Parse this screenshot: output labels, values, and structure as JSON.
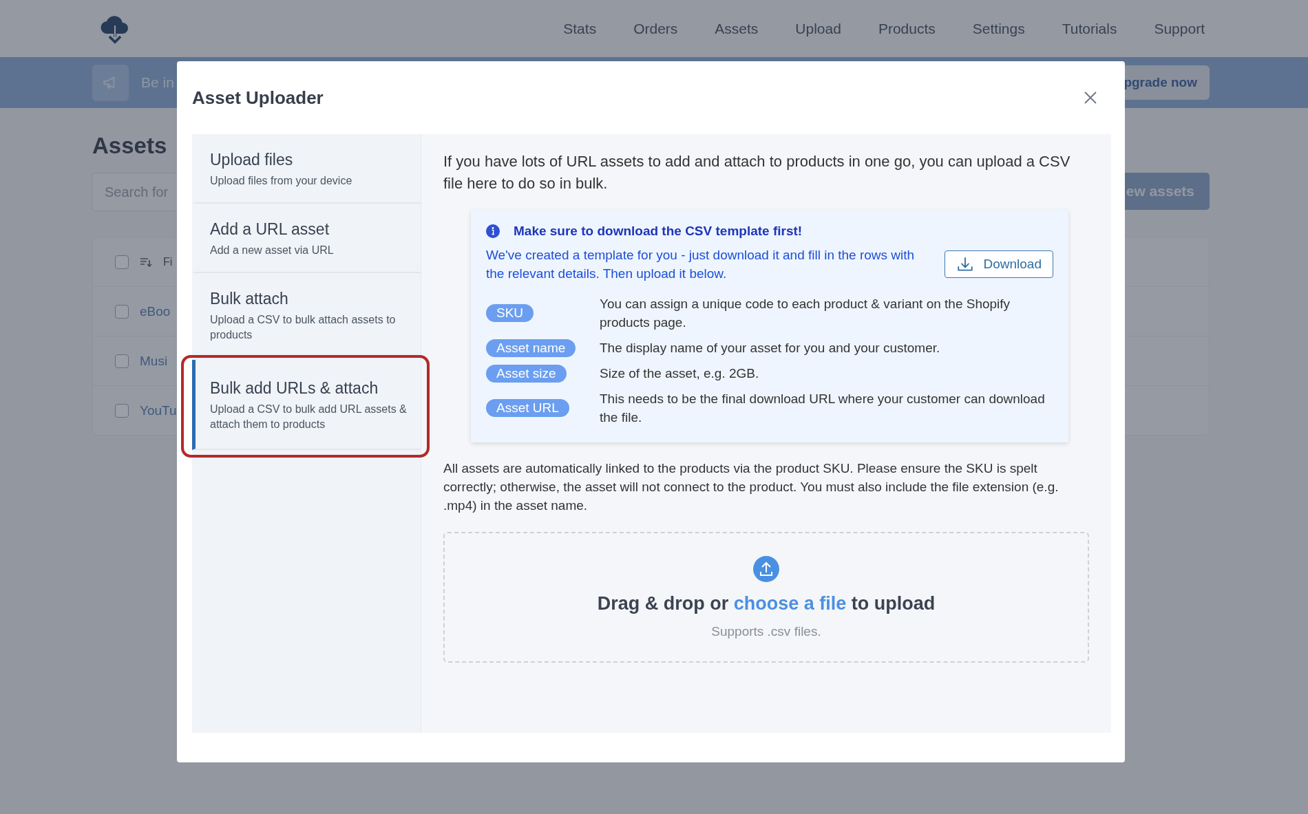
{
  "nav": {
    "items": [
      "Stats",
      "Orders",
      "Assets",
      "Upload",
      "Products",
      "Settings",
      "Tutorials",
      "Support"
    ]
  },
  "banner": {
    "text": "Be in",
    "button": "pgrade now"
  },
  "page": {
    "title": "Assets",
    "search": {
      "placeholder": "Search for"
    },
    "new_button": "ew assets"
  },
  "table": {
    "header": {
      "label": "Fi",
      "checked": false
    },
    "rows": [
      {
        "name": "eBoo",
        "checked": false
      },
      {
        "name": "Musi",
        "checked": false
      },
      {
        "name": "YouTu",
        "checked": false
      }
    ]
  },
  "modal": {
    "title": "Asset Uploader",
    "tabs": [
      {
        "title": "Upload files",
        "subtitle": "Upload files from your device",
        "selected": false,
        "highlighted": false
      },
      {
        "title": "Add a URL asset",
        "subtitle": "Add a new asset via URL",
        "selected": false,
        "highlighted": false
      },
      {
        "title": "Bulk attach",
        "subtitle": "Upload a CSV to bulk attach assets to products",
        "selected": false,
        "highlighted": false
      },
      {
        "title": "Bulk add URLs & attach",
        "subtitle": "Upload a CSV to bulk add URL assets & attach them to products",
        "selected": true,
        "highlighted": true
      }
    ],
    "intro": "If you have lots of URL assets to add and attach to products in one go, you can upload a CSV file here to do so in bulk.",
    "notice": {
      "heading": "Make sure to download the CSV template first!",
      "text": "We've created a template for you - just download it and fill in the rows with the relevant details. Then upload it below.",
      "button": "Download"
    },
    "fields": [
      {
        "tag": "SKU",
        "description": "You can assign a unique code to each product & variant on the Shopify products page."
      },
      {
        "tag": "Asset name",
        "description": "The display name of your asset for you and your customer."
      },
      {
        "tag": "Asset size",
        "description": "Size of the asset, e.g. 2GB."
      },
      {
        "tag": "Asset URL",
        "description": "This needs to be the final download URL where your customer can download the file."
      }
    ],
    "note": "All assets are automatically linked to the products via the product SKU. Please ensure the SKU is spelt correctly; otherwise, the asset will not connect to the product. You must also include the file extension (e.g. .mp4) in the asset name.",
    "dropzone": {
      "prefix": "Drag & drop or",
      "link": "choose a file",
      "suffix": "to upload",
      "hint": "Supports .csv files."
    }
  }
}
